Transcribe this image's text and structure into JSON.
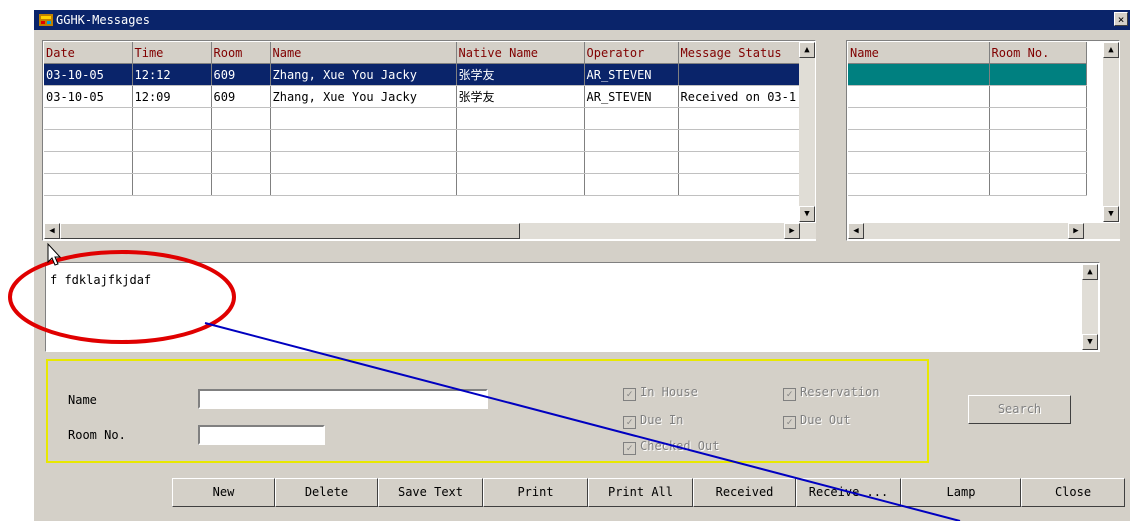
{
  "window": {
    "title": "GGHK-Messages",
    "close_label": "×"
  },
  "messages": {
    "columns": [
      "Date",
      "Time",
      "Room",
      "Name",
      "Native Name",
      "Operator",
      "Message Status"
    ],
    "rows": [
      [
        "03-10-05",
        "12:12",
        "609",
        "Zhang, Xue You Jacky",
        "张学友",
        "AR_STEVEN",
        ""
      ],
      [
        "03-10-05",
        "12:09",
        "609",
        "Zhang, Xue You Jacky",
        "张学友",
        "AR_STEVEN",
        "Received on 03-1"
      ],
      [
        "",
        "",
        "",
        "",
        "",
        "",
        ""
      ],
      [
        "",
        "",
        "",
        "",
        "",
        "",
        ""
      ],
      [
        "",
        "",
        "",
        "",
        "",
        "",
        ""
      ],
      [
        "",
        "",
        "",
        "",
        "",
        "",
        ""
      ]
    ]
  },
  "guests": {
    "columns": [
      "Name",
      "Room No."
    ],
    "rows": [
      [
        "",
        ""
      ],
      [
        "",
        ""
      ],
      [
        "",
        ""
      ],
      [
        "",
        ""
      ],
      [
        "",
        ""
      ],
      [
        "",
        ""
      ]
    ]
  },
  "memo": {
    "text": "f fdklajfkjdaf"
  },
  "search": {
    "name_label": "Name",
    "room_label": "Room No.",
    "name_value": "",
    "room_value": "",
    "checks": {
      "in_house": "In House",
      "reservation": "Reservation",
      "due_in": "Due In",
      "due_out": "Due Out",
      "checked_out": "Checked Out"
    },
    "search_button": "Search"
  },
  "buttons": {
    "new": "New",
    "delete": "Delete",
    "save_text": "Save Text",
    "print": "Print",
    "print_all": "Print All",
    "received": "Received",
    "receive": "Receive ...",
    "lamp": "Lamp",
    "close": "Close"
  },
  "colors": {
    "titlebar": "#0a246a",
    "selection": "#0a246a",
    "teal_row": "#008080",
    "header_text": "#800000",
    "highlight_box": "#e8e800",
    "annotation_circle": "#e00000",
    "annotation_line": "#0000c0"
  }
}
